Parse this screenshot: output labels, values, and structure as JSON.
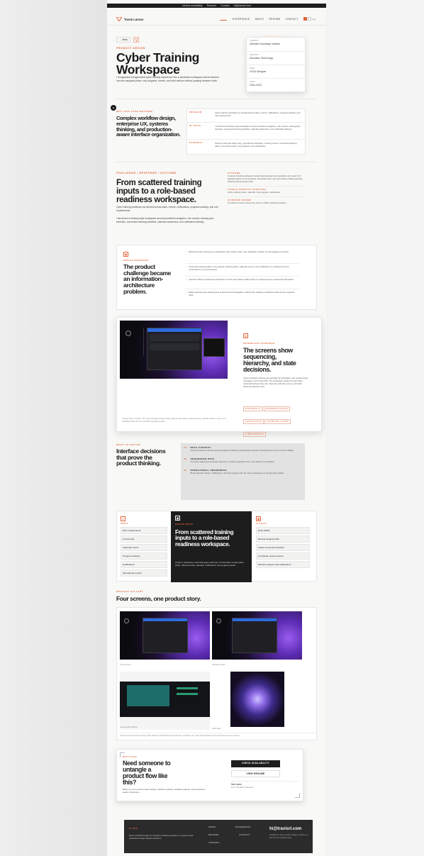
{
  "top": {
    "links": [
      "Limited availability",
      "Resume",
      "Contact",
      "hi@travisrl.com"
    ]
  },
  "nav": {
    "brand": "Travis Larson",
    "links": [
      "EXPERIENCE",
      "ABOUT",
      "RESUME",
      "CONTACT"
    ],
    "toggle": "Dark"
  },
  "hero": {
    "back": "← Work",
    "eyebrow": "PRODUCT DESIGN",
    "title1": "Cyber Training",
    "title2": "Workspace",
    "desc": "I reorganized a fragmented cyber training experience into a persistent workspace where learners can see assigned plans, role progress, events, and next actions without jumping between tools.",
    "facts": [
      {
        "k": "COMPANY",
        "v": "Ultimate Knowledge Institute"
      },
      {
        "k": "INDUSTRY",
        "v": "Education Technology"
      },
      {
        "k": "ROLE",
        "v": "UX/UI Designer"
      },
      {
        "k": "YEAR",
        "v": "2016–2023"
      }
    ]
  },
  "why": {
    "eyebrow": "WHY THIS CASE MATTERS",
    "title": "Complex workflow design, enterprise UX, systems thinking, and production-aware interface organization.",
    "rows": [
      {
        "k": "PROBLEM",
        "v": "Cyber training workflows ran spread across plans, events, notifications, progress tracking, and role requirements."
      },
      {
        "k": "MY ROLE",
        "v": "I structured a desktop-style workspace around persistent navigation, role context, training-plan selection, connected learning activities, calendar awareness, and notification filtering."
      },
      {
        "k": "EVIDENCE",
        "v": "Screens show the lobby entry, operational workspace, Training Center, connected learning paths, upcoming events, role progress, and notifications."
      }
    ]
  },
  "challenge": {
    "eyebrow": "CHALLENGE / RESPONSE / OUTCOME",
    "title": "From scattered training inputs to a role-based readiness workspace.",
    "p1": "Cyber training workflows ran spread across plans, events, notifications, progress tracking, and role requirements.",
    "p2": "I structured a desktop-style workspace around persistent navigation, role context, training-plan selection, connected learning activities, calendar awareness, and notification filtering.",
    "side": [
      {
        "k": "OUTCOME",
        "v": "A clearer training workspace model where learners and operators can move from assigned plans to role progress, scheduled work, and next actions without jumping between disconnected tools."
      },
      {
        "k": "VISIBLE PRODUCT SURFACES",
        "v": "lobby, training center, calendar, role progress, notifications"
      },
      {
        "k": "EVIDENCE SHOWN",
        "v": "4 product screens connect the story to visible interface decisions."
      }
    ]
  },
  "response": {
    "eyebrow": "DESIGN RESPONSE",
    "title": "The product challenge became an information-architecture problem.",
    "items": [
      "Reframed cyber training as a workspace with context, state, and navigation instead of a flat catalog of courses.",
      "Connected training plans, role progress, learning paths, calendar events, and notifications so readiness can be understood in one environment.",
      "Used the lobby-to-workspace transition to orient users before asking them to manage dense operational information.",
      "Made roadmap-style learning feel sequenced and navigable, reducing the floating of scattered tasks across separate tools."
    ]
  },
  "evidence": {
    "eyebrow": "INTERFACE EVIDENCE",
    "title": "The screens show sequencing, hierarchy, and state decisions.",
    "desc": "Cyber readiness training can sprinkle into schedules, role requirements, messages, and course lists. The workspace needed to help users understand where they are, what role path they are on, and what deserves attention next.",
    "caption": "Training center overview. The main workspace brings identity, assigned plan context, learning activity, calendar markers, events, and notification filters into one immediate operating surface.",
    "tags": [
      "WORKSPACE UX",
      "ENTERPRISE TRAINING",
      "LEARNING PATHS",
      "DASHBOARD SYSTEMS",
      "CYBER READINESS"
    ]
  },
  "watch": {
    "eyebrow": "WHAT TO NOTICE",
    "title": "Interface decisions that prove the product thinking.",
    "items": [
      {
        "n": "01",
        "k": "ROLE CONTEXT",
        "v": "Keep the learner oriented around assigned readiness expectations instead of dumping them into a course catalog."
      },
      {
        "n": "02",
        "k": "SEQUENCED PATH",
        "v": "Turn plan states and roadmap steps into a visible progression from next action to completion."
      },
      {
        "n": "03",
        "k": "OPERATIONAL AWARENESS",
        "v": "Bring calendar events, notifications, and role progress into the same workspace so priority stays visible."
      }
    ]
  },
  "model": {
    "left": {
      "eyebrow": "INPUT",
      "items": [
        "Role requirements",
        "Course lists",
        "Calendar events",
        "Progress tracking",
        "Notifications",
        "Operational context"
      ]
    },
    "mid": {
      "eyebrow": "DESIGN MOVE",
      "title": "From scattered training inputs to a role-based readiness workspace.",
      "desc": "Create a workspace model that gives each type of information a clear place: lobby, Training Center, calendar, notifications, and progress panels."
    },
    "right": {
      "eyebrow": "CLARITY",
      "items": [
        "Enter DESK",
        "Review assigned plan",
        "Follow connected activities",
        "Coordinate around events",
        "Monitor progress and notifications"
      ]
    }
  },
  "gallery": {
    "eyebrow": "PROJECT GALLERY",
    "title": "Four screens, one product story.",
    "c1": "Training center",
    "c2": "Workspace detail",
    "c3": "Learning path roadmap",
    "c4": "Lobby state",
    "caption": "Training center overview, learning path roadmap, calendar/progress workspace, and lobby entry state shown together as the sequence reads at a glance."
  },
  "cta": {
    "eyebrow": "NEXT STEP",
    "title": "Need someone to untangle a product flow like this?",
    "desc": "Bring me in for senior product design, interface systems, workflow cleanup, and production-aware UI direction.",
    "b1": "CHECK AVAILABILITY",
    "b2": "VIEW RESUME",
    "next": "Next case",
    "nextsub": "Form Workflow Manager"
  },
  "footer": {
    "eyebrow": "CLOSE",
    "desc": "Senior product design for complex workflow products, ux systems, and production-ready interface direction.",
    "links": [
      "WORK",
      "EXPERIENCE",
      "RESUME",
      "CONTACT",
      "LINKEDIN"
    ],
    "email": "hi@travisrl.com",
    "emailsub": "available for senior product design, systems ux, and front-end product work."
  },
  "colors": {
    "accent": "#e0653a",
    "dark": "#1d1d1d"
  }
}
